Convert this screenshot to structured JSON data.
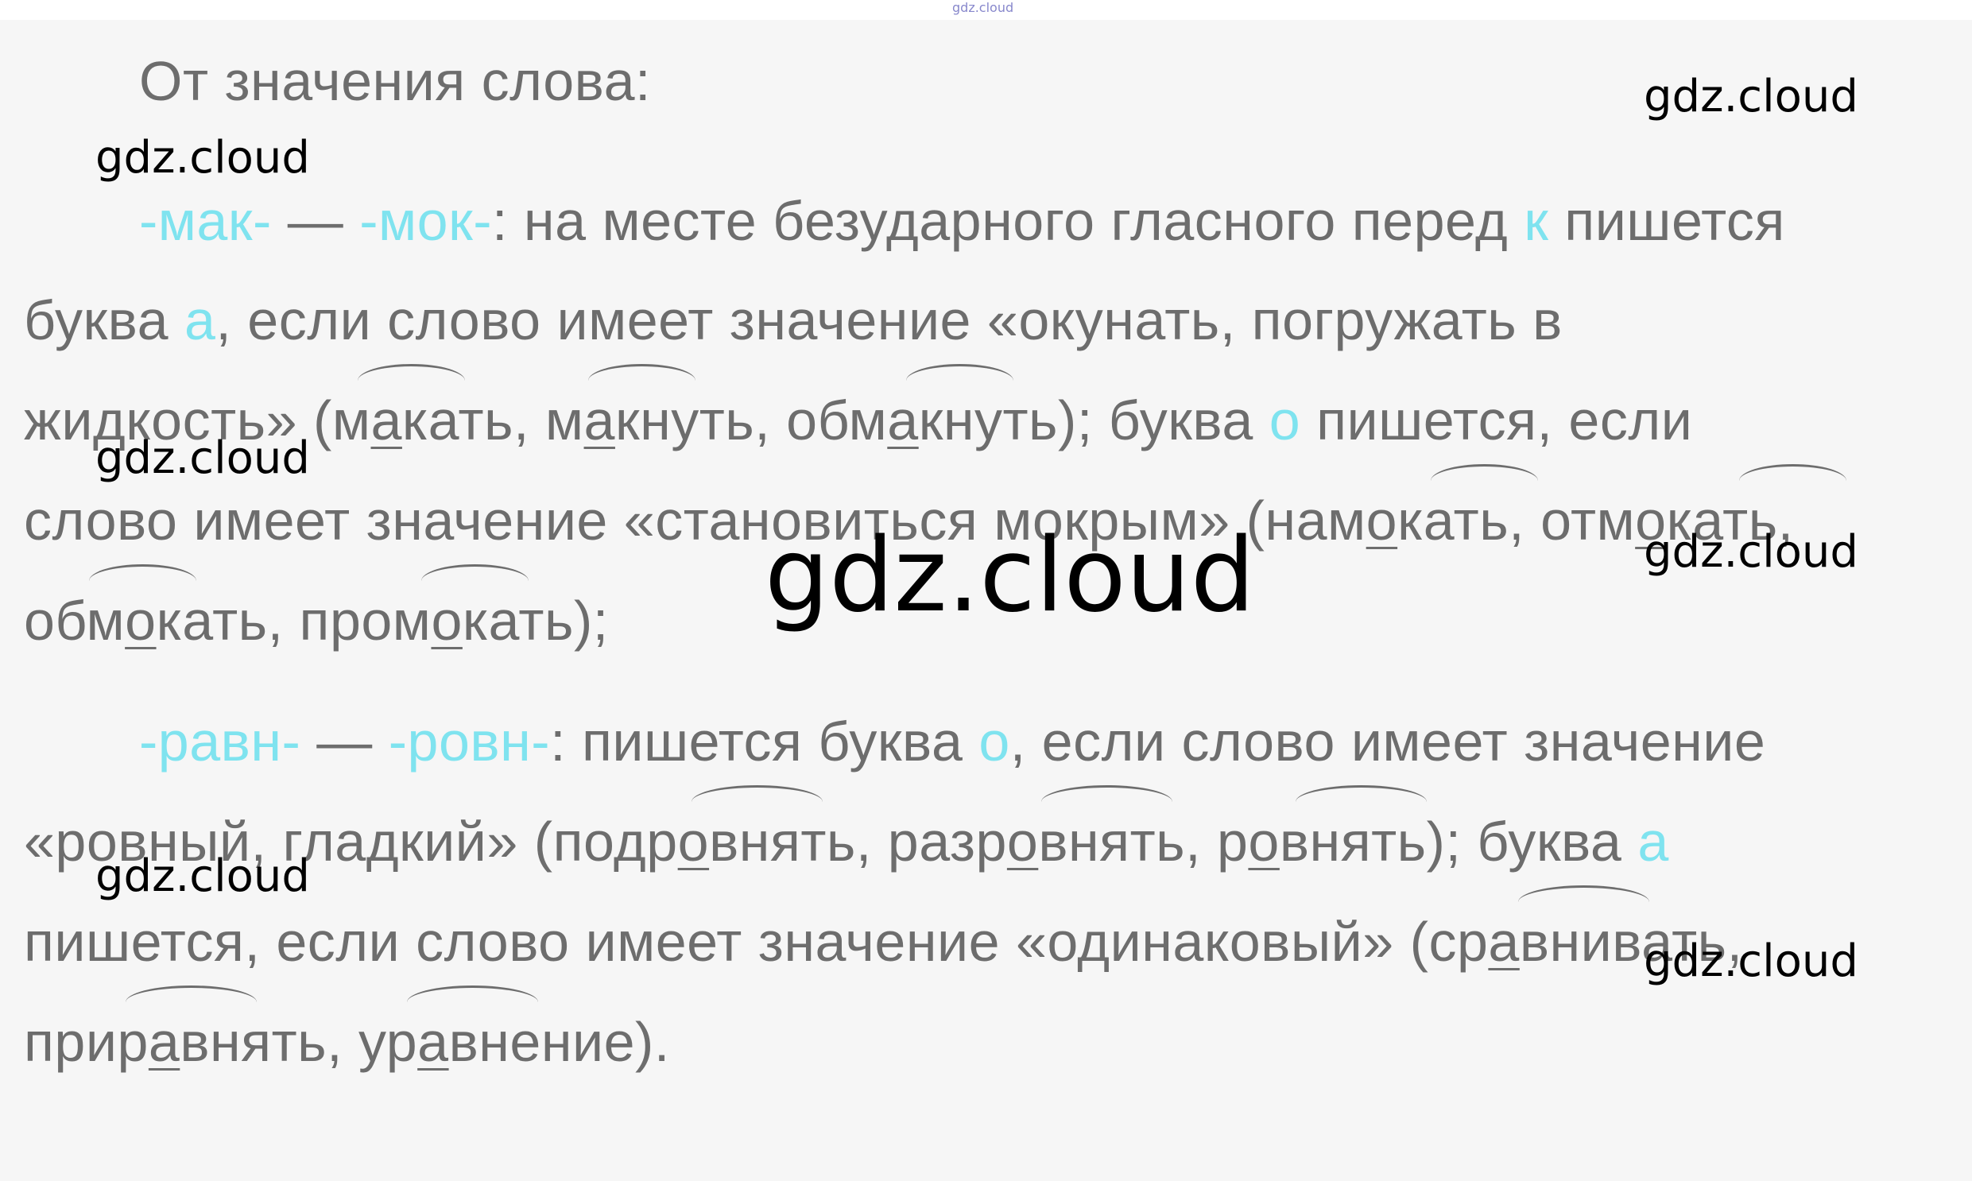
{
  "top_watermark": "gdz.cloud",
  "heading": "От значения слова:",
  "watermarks": [
    "gdz.cloud",
    "gdz.cloud",
    "gdz.cloud",
    "gdz.cloud",
    "gdz.cloud",
    "gdz.cloud",
    "gdz.cloud"
  ],
  "p1": {
    "l1": [
      "-мак-",
      " — ",
      "-мок-",
      ": на месте безударного гласного перед ",
      "к",
      " пишется"
    ],
    "l2": [
      "буква ",
      "а",
      ", если слово имеет значение «окунать, погружать в"
    ],
    "l3": [
      "жидкость» (м",
      "а",
      "кать, м",
      "а",
      "кнуть, обм",
      "а",
      "кнуть); буква ",
      "о",
      " пишется, если"
    ],
    "l4": [
      "слово имеет значение «становиться мокрым» (нам",
      "о",
      "кать, отм",
      "о",
      "кать,"
    ],
    "l5": [
      "обм",
      "о",
      "кать, пром",
      "о",
      "кать);"
    ]
  },
  "p2": {
    "l1": [
      "-равн-",
      " — ",
      "-ровн-",
      ": пишется буква ",
      "о",
      ", если слово имеет значение"
    ],
    "l2": [
      "«ровный, гладкий» (подр",
      "о",
      "внять, разр",
      "о",
      "внять, р",
      "о",
      "внять); буква ",
      "а"
    ],
    "l3": [
      "пишется, если слово имеет значение «одинаковый» (ср",
      "а",
      "внивать,"
    ],
    "l4": [
      "прир",
      "а",
      "внять, ур",
      "а",
      "внение)."
    ]
  }
}
